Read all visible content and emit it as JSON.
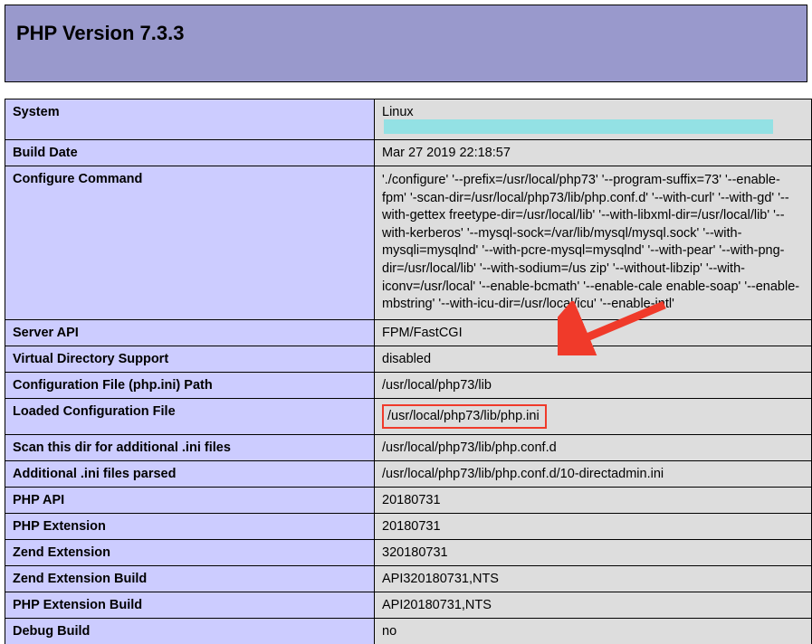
{
  "header": {
    "title": "PHP Version 7.3.3"
  },
  "rows": {
    "system": {
      "label": "System",
      "value_prefix": "Linux"
    },
    "build_date": {
      "label": "Build Date",
      "value": "Mar 27 2019 22:18:57"
    },
    "configure_command": {
      "label": "Configure Command",
      "value": "'./configure' '--prefix=/usr/local/php73' '--program-suffix=73' '--enable-fpm' '-scan-dir=/usr/local/php73/lib/php.conf.d' '--with-curl' '--with-gd' '--with-gettex freetype-dir=/usr/local/lib' '--with-libxml-dir=/usr/local/lib' '--with-kerberos' '--mysql-sock=/var/lib/mysql/mysql.sock' '--with-mysqli=mysqlnd' '--with-pcre-mysql=mysqlnd' '--with-pear' '--with-png-dir=/usr/local/lib' '--with-sodium=/us zip' '--without-libzip' '--with-iconv=/usr/local' '--enable-bcmath' '--enable-cale enable-soap' '--enable-mbstring' '--with-icu-dir=/usr/local/icu' '--enable-intl'"
    },
    "server_api": {
      "label": "Server API",
      "value": "FPM/FastCGI"
    },
    "virtual_directory_support": {
      "label": "Virtual Directory Support",
      "value": "disabled"
    },
    "config_file_path": {
      "label": "Configuration File (php.ini) Path",
      "value": "/usr/local/php73/lib"
    },
    "loaded_config_file": {
      "label": "Loaded Configuration File",
      "value": "/usr/local/php73/lib/php.ini"
    },
    "scan_dir": {
      "label": "Scan this dir for additional .ini files",
      "value": "/usr/local/php73/lib/php.conf.d"
    },
    "additional_parsed": {
      "label": "Additional .ini files parsed",
      "value": "/usr/local/php73/lib/php.conf.d/10-directadmin.ini"
    },
    "php_api": {
      "label": "PHP API",
      "value": "20180731"
    },
    "php_extension": {
      "label": "PHP Extension",
      "value": "20180731"
    },
    "zend_extension": {
      "label": "Zend Extension",
      "value": "320180731"
    },
    "zend_extension_build": {
      "label": "Zend Extension Build",
      "value": "API320180731,NTS"
    },
    "php_extension_build": {
      "label": "PHP Extension Build",
      "value": "API20180731,NTS"
    },
    "debug_build": {
      "label": "Debug Build",
      "value": "no"
    }
  },
  "annotation": {
    "arrow_target": "loaded_config_file",
    "arrow_color": "#f03a2a"
  }
}
